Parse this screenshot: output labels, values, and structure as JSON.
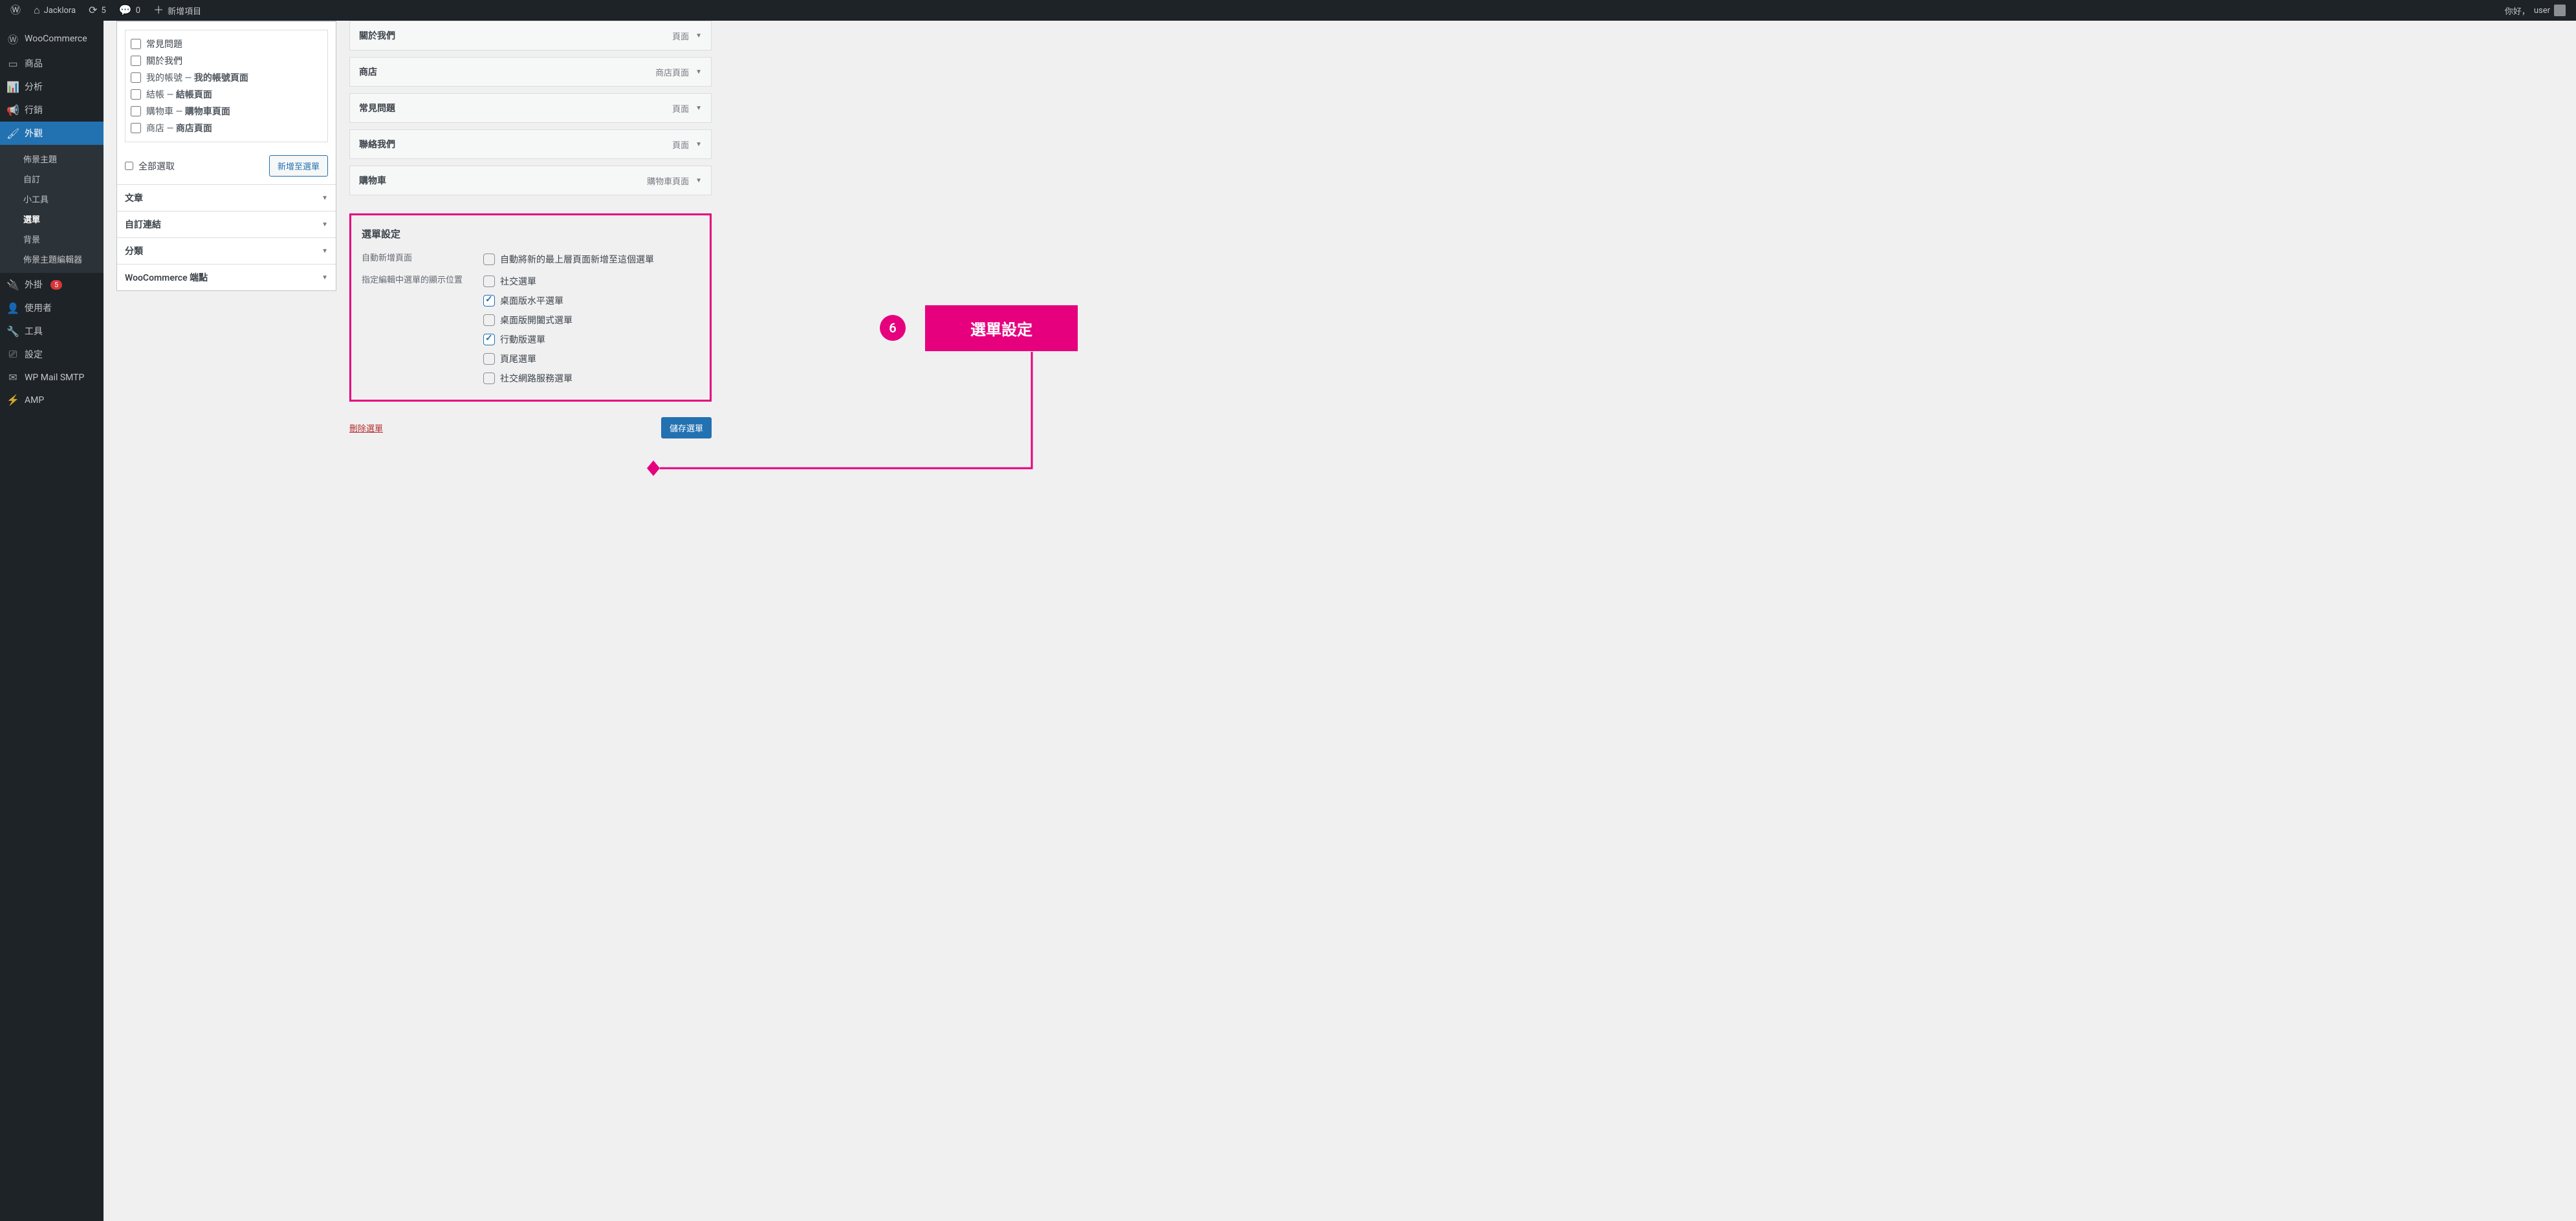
{
  "adminbar": {
    "wp_icon": "ⓦ",
    "site_name": "Jacklora",
    "updates": "5",
    "comments": "0",
    "new_label": "新增項目",
    "greeting": "你好，",
    "user": "user"
  },
  "sidebar": {
    "items": [
      {
        "icon": "🅦",
        "label": "WooCommerce"
      },
      {
        "icon": "▭",
        "label": "商品"
      },
      {
        "icon": "📊",
        "label": "分析"
      },
      {
        "icon": "📢",
        "label": "行銷"
      },
      {
        "icon": "🖌",
        "label": "外觀",
        "current": true
      },
      {
        "icon": "🔌",
        "label": "外掛",
        "badge": "5"
      },
      {
        "icon": "👤",
        "label": "使用者"
      },
      {
        "icon": "🔧",
        "label": "工具"
      },
      {
        "icon": "⚙",
        "label": "設定"
      },
      {
        "icon": "✉",
        "label": "WP Mail SMTP"
      },
      {
        "icon": "⚡",
        "label": "AMP"
      }
    ],
    "submenu": [
      {
        "label": "佈景主題"
      },
      {
        "label": "自訂"
      },
      {
        "label": "小工具"
      },
      {
        "label": "選單",
        "current": true
      },
      {
        "label": "背景"
      },
      {
        "label": "佈景主題編輯器"
      }
    ]
  },
  "pages_box": {
    "items": [
      {
        "label": "常見問題"
      },
      {
        "label": "關於我們"
      },
      {
        "label": "我的帳號 — ",
        "bold": "我的帳號頁面"
      },
      {
        "label": "結帳 — ",
        "bold": "結帳頁面"
      },
      {
        "label": "購物車 — ",
        "bold": "購物車頁面"
      },
      {
        "label": "商店 — ",
        "bold": "商店頁面"
      }
    ],
    "select_all": "全部選取",
    "add_btn": "新增至選單"
  },
  "accordions": [
    {
      "label": "文章"
    },
    {
      "label": "自訂連結"
    },
    {
      "label": "分類"
    },
    {
      "label": "WooCommerce 端點"
    }
  ],
  "menu_structure": [
    {
      "title": "關於我們",
      "type": "頁面"
    },
    {
      "title": "商店",
      "type": "商店頁面"
    },
    {
      "title": "常見問題",
      "type": "頁面"
    },
    {
      "title": "聯絡我們",
      "type": "頁面"
    },
    {
      "title": "購物車",
      "type": "購物車頁面"
    }
  ],
  "settings": {
    "heading": "選單設定",
    "auto_add_label": "自動新增頁面",
    "auto_add_opt": "自動將新的最上層頁面新增至這個選單",
    "locations_label": "指定編輯中選單的顯示位置",
    "locations": [
      {
        "label": "社交選單",
        "checked": false
      },
      {
        "label": "桌面版水平選單",
        "checked": true
      },
      {
        "label": "桌面版開闔式選單",
        "checked": false
      },
      {
        "label": "行動版選單",
        "checked": true
      },
      {
        "label": "頁尾選單",
        "checked": false
      },
      {
        "label": "社交網路服務選單",
        "checked": false
      }
    ]
  },
  "footer": {
    "delete": "刪除選單",
    "save": "儲存選單"
  },
  "annotation": {
    "num": "6",
    "text": "選單設定"
  }
}
